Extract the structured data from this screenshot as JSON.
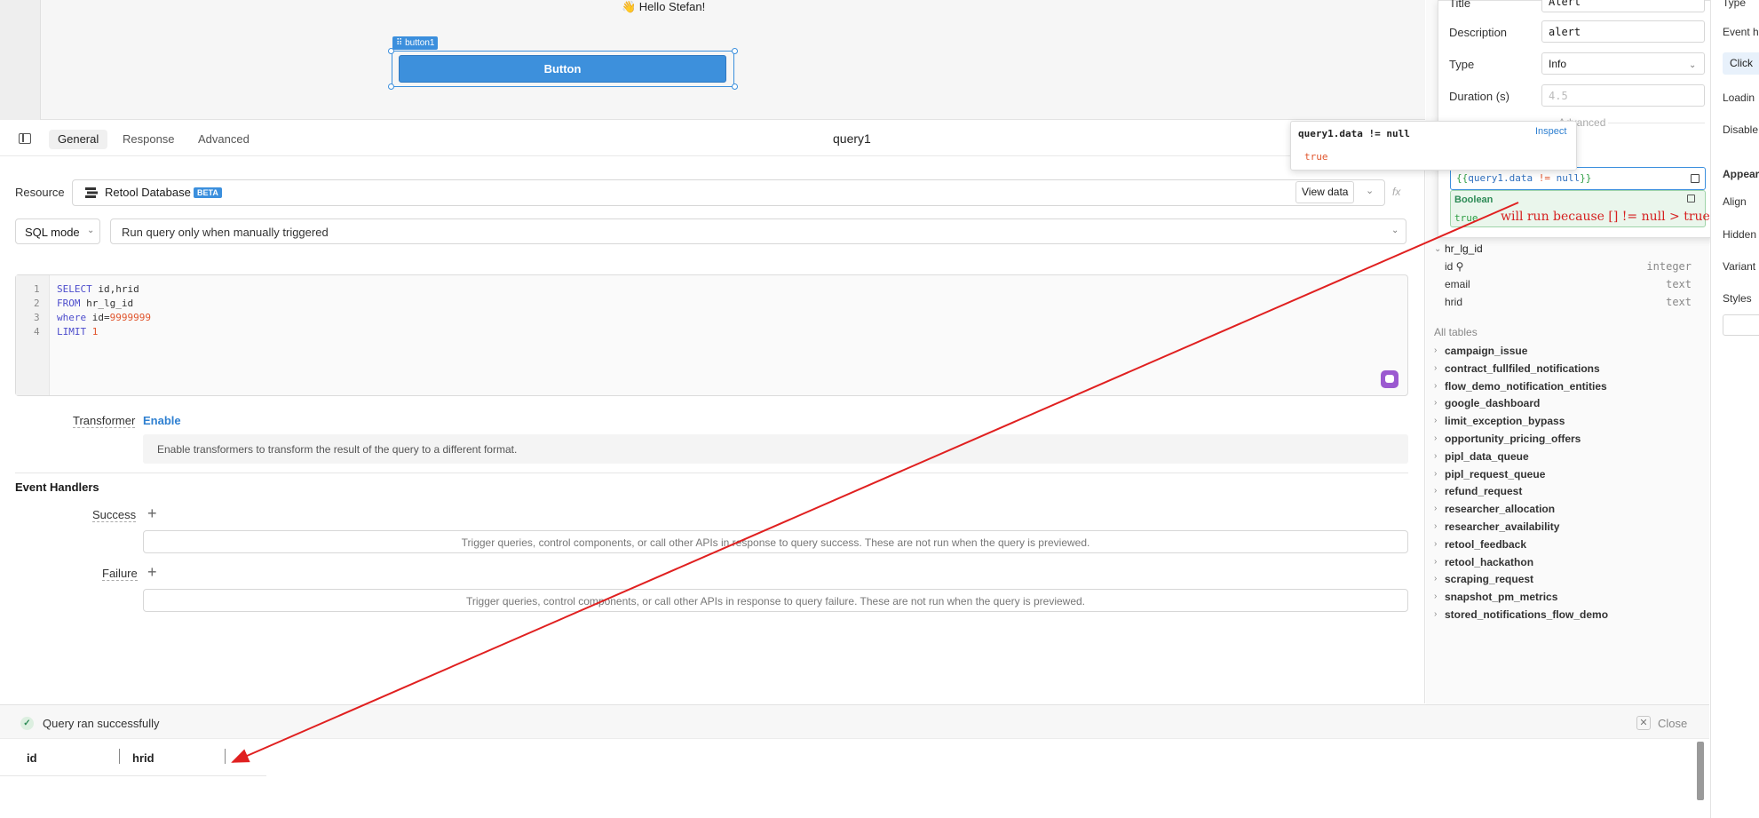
{
  "canvas": {
    "greeting": "👋 Hello Stefan!",
    "selected_label": "⠿ button1",
    "button_label": "Button"
  },
  "query_panel": {
    "tabs": [
      "General",
      "Response",
      "Advanced"
    ],
    "title": "query1",
    "resource_label": "Resource",
    "resource_name": "Retool Database",
    "resource_badge": "BETA",
    "view_data": "View data",
    "fx": "fx",
    "mode": "SQL mode",
    "trigger": "Run query only when manually triggered",
    "sql_lines": [
      {
        "num": "1",
        "parts": [
          {
            "t": "SELECT ",
            "c": "kw"
          },
          {
            "t": "id,hrid",
            "c": ""
          }
        ]
      },
      {
        "num": "2",
        "parts": [
          {
            "t": "FROM ",
            "c": "kw"
          },
          {
            "t": "hr_lg_id",
            "c": ""
          }
        ]
      },
      {
        "num": "3",
        "parts": [
          {
            "t": "where ",
            "c": "kw"
          },
          {
            "t": "id=",
            "c": ""
          },
          {
            "t": "9999999",
            "c": "num"
          }
        ]
      },
      {
        "num": "4",
        "parts": [
          {
            "t": "LIMIT ",
            "c": "kw"
          },
          {
            "t": "1",
            "c": "num"
          }
        ]
      }
    ],
    "transformer_label": "Transformer",
    "transformer_enable": "Enable",
    "transformer_help": "Enable transformers to transform the result of the query to a different format.",
    "event_handlers_title": "Event Handlers",
    "success_label": "Success",
    "success_help": "Trigger queries, control components, or call other APIs in response to query success. These are not run when the query is previewed.",
    "failure_label": "Failure",
    "failure_help": "Trigger queries, control components, or call other APIs in response to query failure. These are not run when the query is previewed."
  },
  "results": {
    "status": "Query ran successfully",
    "close": "Close",
    "columns": [
      "id",
      "hrid"
    ]
  },
  "schema": {
    "table": "hr_lg_id",
    "columns": [
      {
        "name": "id",
        "key": "⚲",
        "type": "integer"
      },
      {
        "name": "email",
        "key": "",
        "type": "text"
      },
      {
        "name": "hrid",
        "key": "",
        "type": "text"
      }
    ],
    "all_tables_label": "All tables",
    "tables": [
      "campaign_issue",
      "contract_fullfiled_notifications",
      "flow_demo_notification_entities",
      "google_dashboard",
      "limit_exception_bypass",
      "opportunity_pricing_offers",
      "pipl_data_queue",
      "pipl_request_queue",
      "refund_request",
      "researcher_allocation",
      "researcher_availability",
      "retool_feedback",
      "retool_hackathon",
      "scraping_request",
      "snapshot_pm_metrics",
      "stored_notifications_flow_demo"
    ]
  },
  "inspector": {
    "title_label": "Title",
    "title_value": "Alert",
    "description_label": "Description",
    "description_value": "alert",
    "type_label": "Type",
    "type_value": "Info",
    "duration_label": "Duration (s)",
    "duration_placeholder": "4.5",
    "advanced_label": "Advanced",
    "expression_parts": [
      {
        "t": "{{",
        "c": "ex-g"
      },
      {
        "t": "query1.data ",
        "c": "ex-b"
      },
      {
        "t": "!= ",
        "c": "ex-o"
      },
      {
        "t": "null",
        "c": "ex-b"
      },
      {
        "t": "}}",
        "c": "ex-g"
      }
    ],
    "result_type": "Boolean",
    "result_value": "true",
    "annotation": "will run because [] != null > true"
  },
  "popover": {
    "expression": "query1.data != null",
    "inspect": "Inspect",
    "value": "true"
  },
  "right_panel": {
    "labels": [
      "Type",
      "Event h",
      "Loadin",
      "Disable",
      "Appear",
      "Align",
      "Hidden",
      "Variant",
      "Styles"
    ],
    "click_value": "Click"
  },
  "colors": {
    "accent": "#3b8fdd",
    "annotation": "#d62020",
    "success": "#2e8b57"
  }
}
